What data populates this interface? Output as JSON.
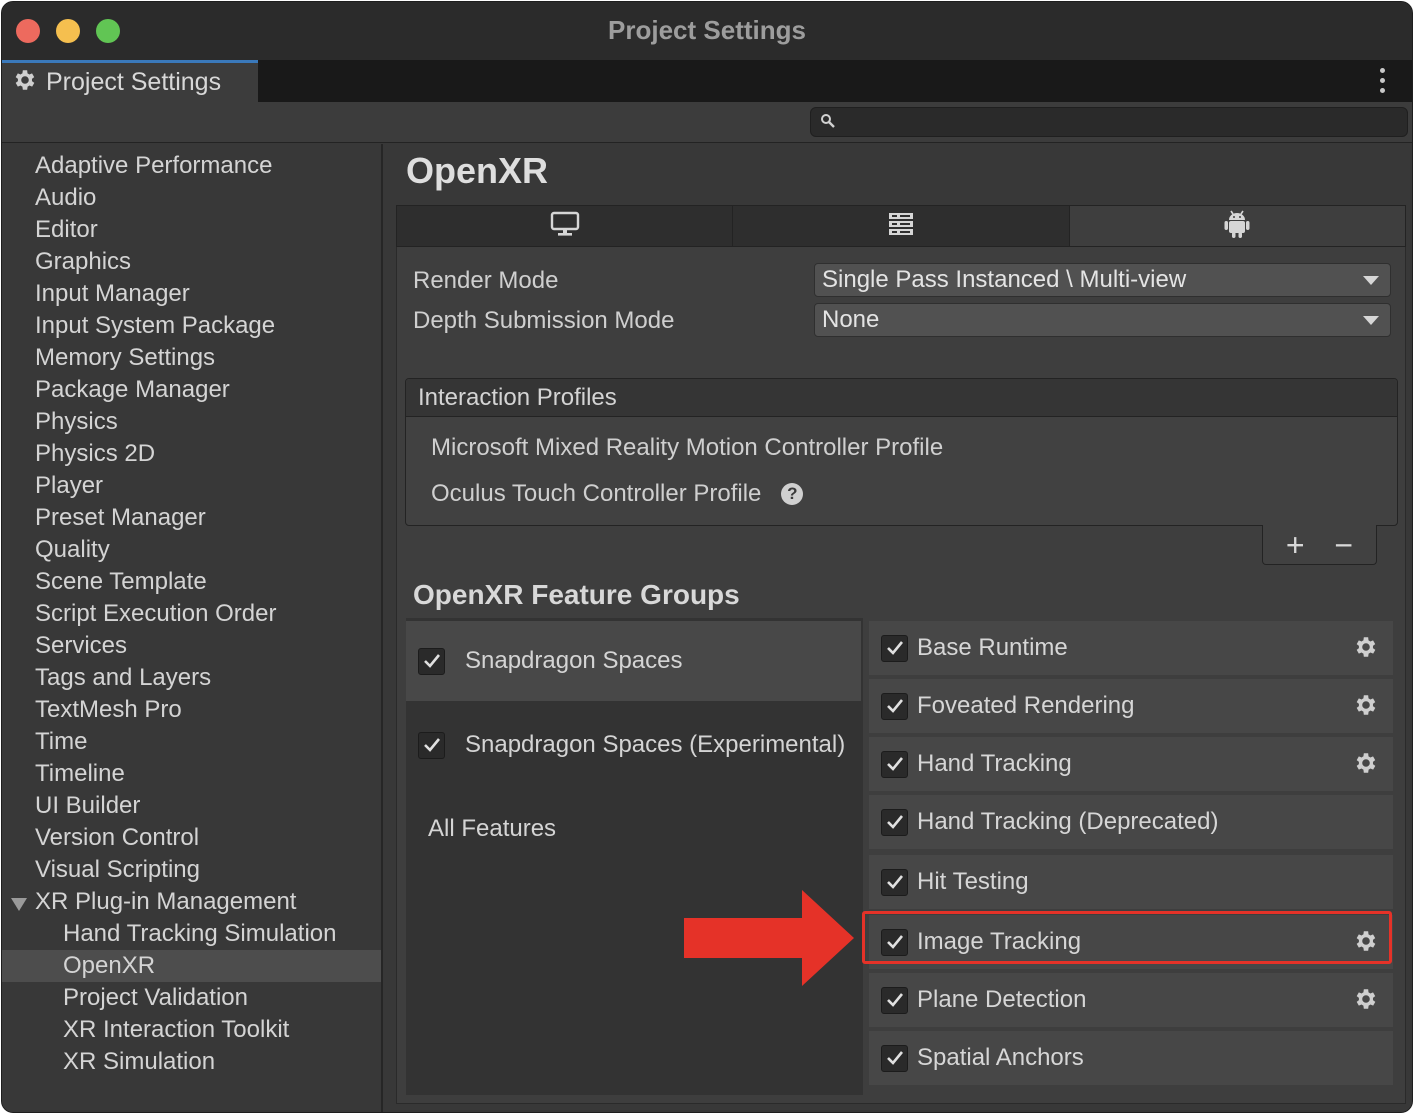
{
  "window": {
    "title": "Project Settings"
  },
  "tab": {
    "label": "Project Settings"
  },
  "search": {
    "placeholder": ""
  },
  "sidebar": {
    "items": [
      "Adaptive Performance",
      "Audio",
      "Editor",
      "Graphics",
      "Input Manager",
      "Input System Package",
      "Memory Settings",
      "Package Manager",
      "Physics",
      "Physics 2D",
      "Player",
      "Preset Manager",
      "Quality",
      "Scene Template",
      "Script Execution Order",
      "Services",
      "Tags and Layers",
      "TextMesh Pro",
      "Time",
      "Timeline",
      "UI Builder",
      "Version Control",
      "Visual Scripting",
      "XR Plug-in Management"
    ],
    "sub_items": [
      "Hand Tracking Simulation",
      "OpenXR",
      "Project Validation",
      "XR Interaction Toolkit",
      "XR Simulation"
    ],
    "selected": "OpenXR"
  },
  "main": {
    "title": "OpenXR",
    "platform_tabs": [
      "desktop-icon",
      "server-icon",
      "android-icon"
    ],
    "selected_platform": "android-icon",
    "render_mode": {
      "label": "Render Mode",
      "value": "Single Pass Instanced \\ Multi-view"
    },
    "depth_mode": {
      "label": "Depth Submission Mode",
      "value": "None"
    },
    "interaction_profiles": {
      "header": "Interaction Profiles",
      "items": [
        "Microsoft Mixed Reality Motion Controller Profile",
        "Oculus Touch Controller Profile"
      ],
      "add": "+",
      "remove": "−"
    },
    "feature_groups": {
      "title": "OpenXR Feature Groups",
      "groups": [
        {
          "label": "Snapdragon Spaces",
          "checked": true,
          "selected": true
        },
        {
          "label": "Snapdragon Spaces (Experimental)",
          "checked": true,
          "selected": false
        },
        {
          "label": "All Features",
          "checked": false,
          "selected": false
        }
      ],
      "features": [
        {
          "label": "Base Runtime",
          "checked": true,
          "settings": true
        },
        {
          "label": "Foveated Rendering",
          "checked": true,
          "settings": true
        },
        {
          "label": "Hand Tracking",
          "checked": true,
          "settings": true
        },
        {
          "label": "Hand Tracking (Deprecated)",
          "checked": true,
          "settings": false
        },
        {
          "label": "Hit Testing",
          "checked": true,
          "settings": false
        },
        {
          "label": "Image Tracking",
          "checked": true,
          "settings": true
        },
        {
          "label": "Plane Detection",
          "checked": true,
          "settings": true
        },
        {
          "label": "Spatial Anchors",
          "checked": true,
          "settings": false
        }
      ],
      "highlighted": "Image Tracking"
    }
  },
  "colors": {
    "accent_highlight": "#e53228",
    "tab_accent": "#3a79bb"
  }
}
